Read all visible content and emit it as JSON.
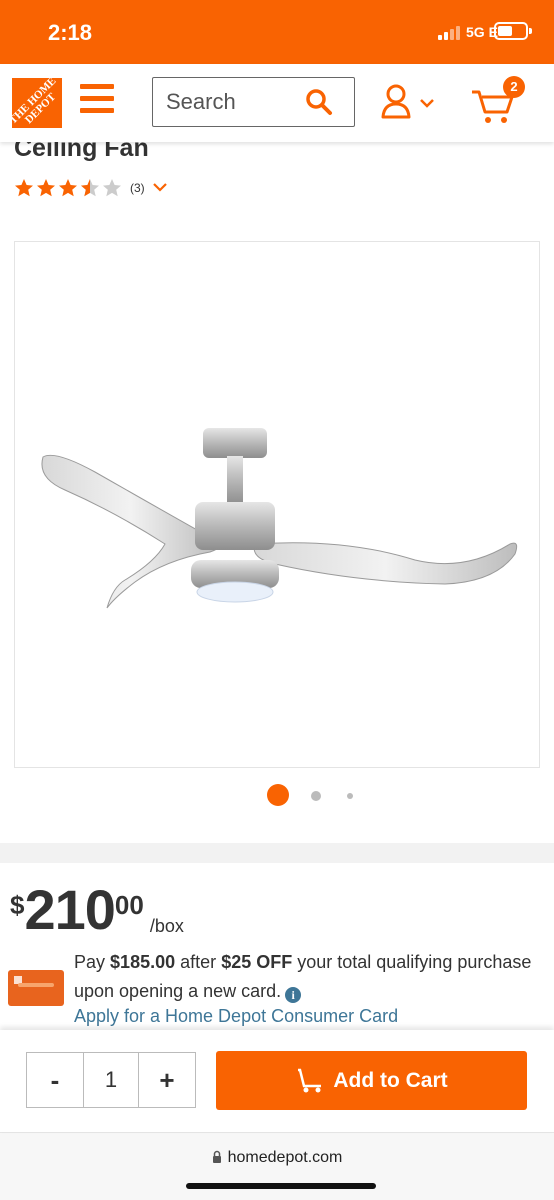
{
  "status_bar": {
    "time": "2:18",
    "network": "5G E"
  },
  "header": {
    "logo_text": "THE HOME DEPOT",
    "search": {
      "placeholder": "Search"
    },
    "cart_count": "2",
    "icons": {
      "menu": "hamburger-menu-icon",
      "search": "search-icon",
      "account": "user-icon",
      "cart": "cart-icon"
    }
  },
  "product": {
    "title": "Ceiling Fan",
    "rating": {
      "stars": 3.5,
      "max_stars": 5,
      "review_count": "(3)"
    },
    "carousel": {
      "active_index": 0,
      "total": 3
    }
  },
  "pricing": {
    "currency": "$",
    "dollars": "210",
    "cents": "00",
    "unit": "/box",
    "promo": {
      "pay_prefix": "Pay",
      "pay_amount": "$185.00",
      "after_text": "after",
      "discount": "$25 OFF",
      "rest_text": "your total qualifying purchase upon opening a new card.",
      "apply_link": "Apply for a Home Depot Consumer Card"
    }
  },
  "cart_bar": {
    "minus_label": "-",
    "quantity": "1",
    "plus_label": "+",
    "add_label": "Add to Cart"
  },
  "browser": {
    "url": "homedepot.com"
  },
  "colors": {
    "brand_orange": "#f96302",
    "link_blue": "#3e7697",
    "text": "#333333"
  }
}
